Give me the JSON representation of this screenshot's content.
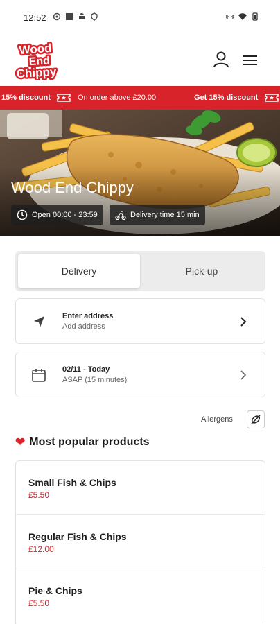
{
  "status_bar": {
    "time": "12:52",
    "left_icons": [
      "settings-icon",
      "square-icon",
      "android-icon",
      "shield-icon"
    ],
    "right_icons": [
      "link-icon",
      "wifi-icon",
      "battery-icon"
    ]
  },
  "header": {
    "logo_text": [
      "Wood",
      "End",
      "Chippy"
    ],
    "icons": [
      "user-icon",
      "menu-icon"
    ]
  },
  "banner": {
    "left_text": "15% discount",
    "middle_text": "On order above £20.00",
    "right_text": "Get 15% discount",
    "color": "#d8232a"
  },
  "hero": {
    "title": "Wood End Chippy",
    "opening_hours": "Open 00:00 - 23:59",
    "delivery_time": "Delivery time 15 min"
  },
  "order_type": {
    "options": [
      "Delivery",
      "Pick-up"
    ],
    "selected": "Delivery"
  },
  "address_card": {
    "title": "Enter address",
    "subtitle": "Add address"
  },
  "time_card": {
    "title": "02/11 - Today",
    "subtitle": "ASAP (15 minutes)"
  },
  "allergens": {
    "label": "Allergens"
  },
  "popular": {
    "title": "Most popular products",
    "products": [
      {
        "name": "Small Fish & Chips",
        "price": "£5.50"
      },
      {
        "name": "Regular Fish & Chips",
        "price": "£12.00"
      },
      {
        "name": "Pie & Chips",
        "price": "£5.50"
      }
    ]
  },
  "colors": {
    "accent": "#d8232a",
    "price": "#d8232a"
  }
}
